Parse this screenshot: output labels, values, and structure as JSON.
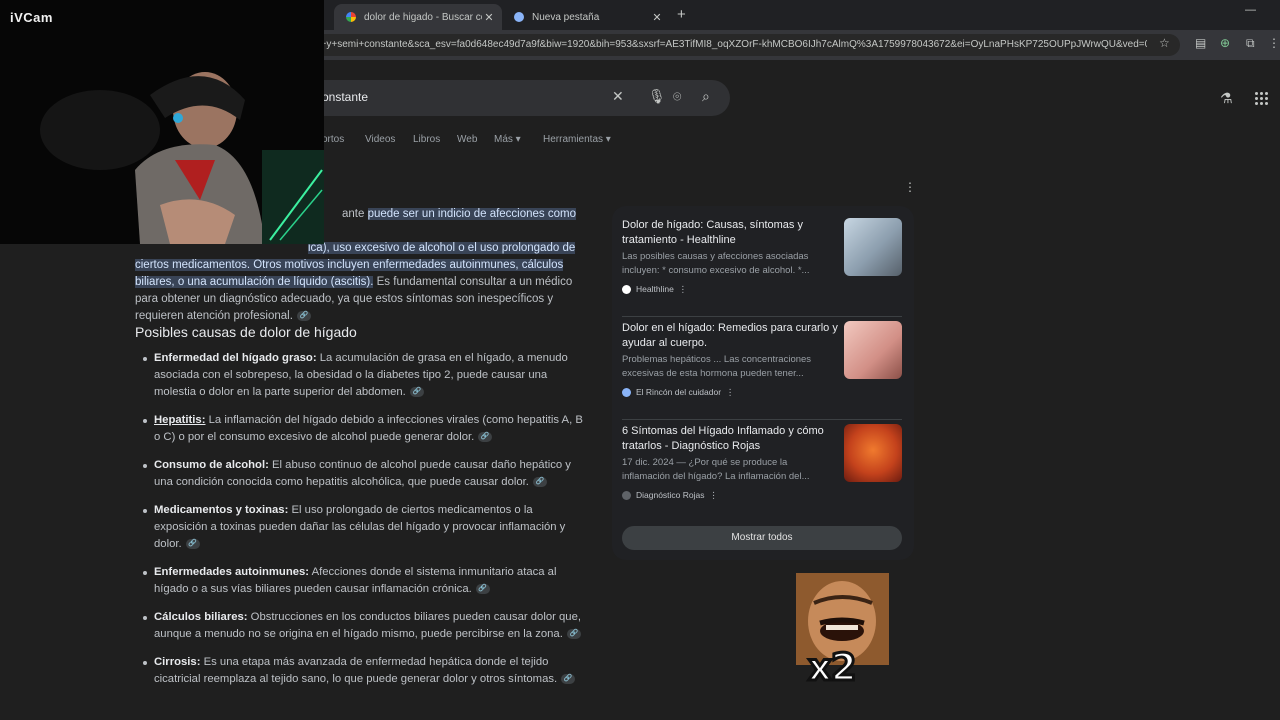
{
  "tabs": [
    {
      "title": "dolor de higado - Buscar con G",
      "active": true
    },
    {
      "title": "Nueva pestaña",
      "active": false
    }
  ],
  "url": "e+y+semi+constante&sca_esv=fa0d648ec49d7a9f&biw=1920&bih=953&sxsrf=AE3TifMI8_oqXZOrF-khMCBO6IJh7cAlmQ%3A1759978043672&ei=OyLnaPHsKP725OUPpJWrwQU&ved=0...",
  "search": {
    "query": "onstante"
  },
  "filters": [
    "ortos",
    "Videos",
    "Libros",
    "Web",
    "Más ▾",
    "Herramientas ▾"
  ],
  "answer": {
    "part1": "ante ",
    "hl1": "puede ser un indicio de afecciones como el",
    "hl2": "ica), uso excesivo de alcohol o el uso prolongado de ciertos medicamentos.  Otros motivos incluyen enfermedades autoinmunes, cálculos biliares, o una acumulación de líquido (ascitis).",
    "rest": " Es fundamental consultar a un médico para obtener un diagnóstico adecuado, ya que estos síntomas son inespecíficos y requieren atención profesional."
  },
  "causes_heading": "Posibles causas de dolor de hígado",
  "causes": [
    {
      "term": "Enfermedad del hígado graso:",
      "text": " La acumulación de grasa en el hígado, a menudo asociada con el sobrepeso, la obesidad o la diabetes tipo 2, puede causar una molestia o dolor en la parte superior del abdomen."
    },
    {
      "term": "Hepatitis:",
      "text": " La inflamación del hígado debido a infecciones virales (como hepatitis A, B o C) o por el consumo excesivo de alcohol puede generar dolor."
    },
    {
      "term": "Consumo de alcohol:",
      "text": " El abuso continuo de alcohol puede causar daño hepático y una condición conocida como hepatitis alcohólica, que puede causar dolor."
    },
    {
      "term": "Medicamentos y toxinas:",
      "text": " El uso prolongado de ciertos medicamentos o la exposición a toxinas pueden dañar las células del hígado y provocar inflamación y dolor."
    },
    {
      "term": "Enfermedades autoinmunes:",
      "text": " Afecciones donde el sistema inmunitario ataca al hígado o a sus vías biliares pueden causar inflamación crónica."
    },
    {
      "term": "Cálculos biliares:",
      "text": " Obstrucciones en los conductos biliares pueden causar dolor que, aunque a menudo no se origina en el hígado mismo, puede percibirse en la zona."
    },
    {
      "term": "Cirrosis:",
      "text": " Es una etapa más avanzada de enfermedad hepática donde el tejido cicatricial reemplaza al tejido sano, lo que puede generar dolor y otros síntomas."
    }
  ],
  "panel": {
    "cards": [
      {
        "title": "Dolor de hígado: Causas, síntomas y tratamiento - Healthline",
        "snippet": "Las posibles causas y afecciones asociadas incluyen: * consumo excesivo de alcohol. *...",
        "source": "Healthline"
      },
      {
        "title": "Dolor en el hígado: Remedios para curarlo y ayudar al cuerpo.",
        "snippet": "Problemas hepáticos ... Las concentraciones excesivas de esta hormona pueden tener...",
        "source": "El Rincón del cuidador"
      },
      {
        "title": "6 Síntomas del Hígado Inflamado y cómo tratarlos - Diagnóstico Rojas",
        "snippet": "17 dic. 2024 — ¿Por qué se produce la inflamación del hígado? La inflamación del...",
        "source": "Diagnóstico Rojas"
      }
    ],
    "show_all": "Mostrar todos"
  },
  "overlay": {
    "webcam_label": "iVCam",
    "multiplier": "x2"
  },
  "colors": {
    "background": "#1f1f1f",
    "highlight": "#394457",
    "panel": "#202124"
  }
}
